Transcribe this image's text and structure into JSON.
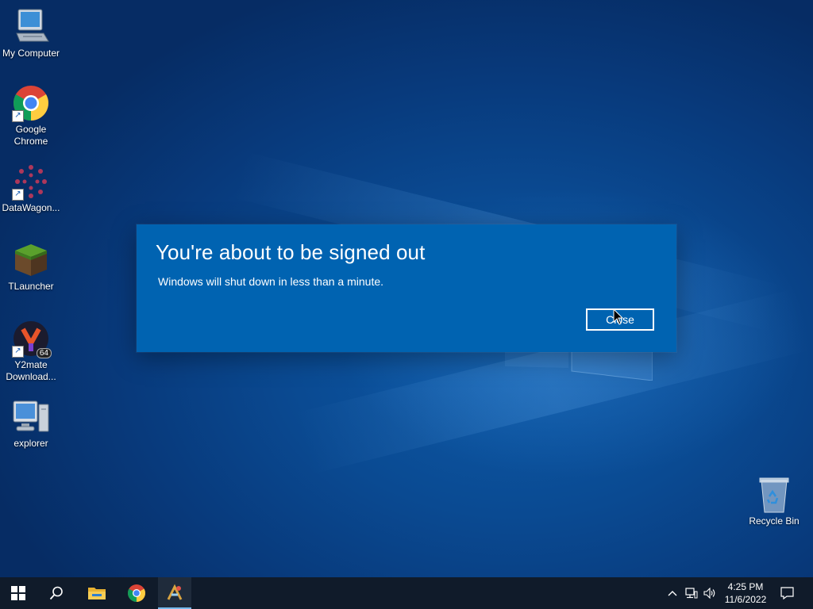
{
  "desktop": {
    "icons": [
      {
        "label": "My Computer"
      },
      {
        "label": "Google Chrome"
      },
      {
        "label": "DataWagon..."
      },
      {
        "label": "TLauncher"
      },
      {
        "label": "Y2mate Download..."
      },
      {
        "label": "explorer"
      },
      {
        "label": "Recycle Bin"
      }
    ],
    "y2mate_badge": "64"
  },
  "dialog": {
    "title": "You're about to be signed out",
    "message": "Windows will shut down in less than a minute.",
    "close_label": "Close",
    "background": "#0063b1"
  },
  "taskbar": {
    "apps": [
      {
        "icon": "windows-start-icon"
      },
      {
        "icon": "search-icon"
      },
      {
        "icon": "file-explorer-icon"
      },
      {
        "icon": "chrome-icon"
      },
      {
        "icon": "tlauncher-icon"
      }
    ],
    "time": "4:25 PM",
    "date": "11/6/2022"
  },
  "colors": {
    "taskbar": "#101b2a",
    "accent": "#76b9ed"
  }
}
